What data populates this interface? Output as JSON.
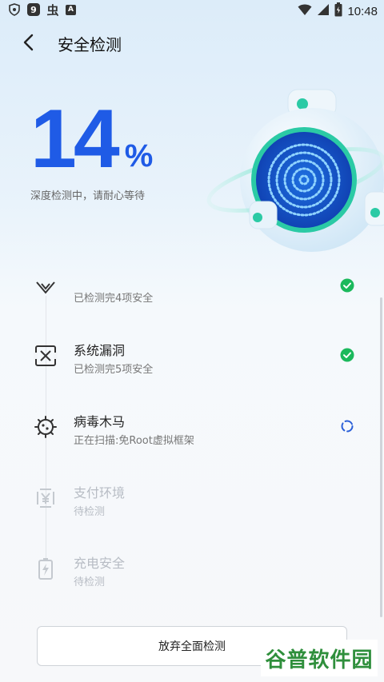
{
  "status_bar": {
    "time": "10:48",
    "left_icons": [
      "shield-heart-icon",
      "circle-9-icon",
      "bug-icon",
      "a-box-icon"
    ],
    "right_icons": [
      "wifi-icon",
      "signal-icon",
      "battery-icon"
    ],
    "glyph_9": "9",
    "glyph_bug": "虫",
    "glyph_a": "A"
  },
  "header": {
    "title": "安全检测"
  },
  "progress": {
    "value": "14",
    "sign": "%",
    "subtitle": "深度检测中，请耐心等待"
  },
  "items": [
    {
      "name": "",
      "status": "已检测完4项安全",
      "state": "done",
      "icon": "wifi-check-icon"
    },
    {
      "name": "系统漏洞",
      "status": "已检测完5项安全",
      "state": "done",
      "icon": "system-scan-icon"
    },
    {
      "name": "病毒木马",
      "status": "正在扫描:免Root虚拟框架",
      "state": "scanning",
      "icon": "virus-icon"
    },
    {
      "name": "支付环境",
      "status": "待检测",
      "state": "pending",
      "icon": "payment-icon"
    },
    {
      "name": "充电安全",
      "status": "待检测",
      "state": "pending",
      "icon": "battery-charge-icon"
    }
  ],
  "actions": {
    "abort_label": "放弃全面检测"
  },
  "watermark": {
    "text": "谷普软件园"
  },
  "colors": {
    "accent": "#1f5be6",
    "success": "#1bb95c",
    "scanning": "#2a5fd8",
    "pending": "#b7bcc4"
  }
}
